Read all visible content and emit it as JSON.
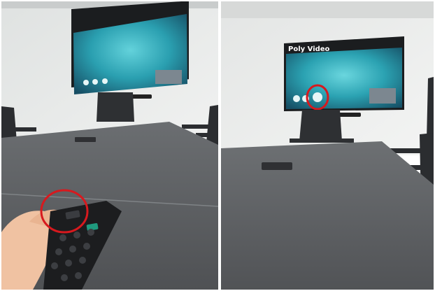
{
  "photos": [
    {
      "id": "left",
      "description_hidden": true,
      "tv_title": "",
      "highlight": "remote-button"
    },
    {
      "id": "right",
      "tv_title": "Poly Video",
      "highlight": "tv-selected-icon"
    }
  ],
  "colors": {
    "wall": "#e9ebea",
    "table": "#5a5c5f",
    "screen_teal": "#3fb7c6",
    "highlight_red": "#d7191e",
    "remote_green": "#1f9a7e"
  },
  "icons": [
    "tv-app-icon",
    "remote-control",
    "chair-icon"
  ]
}
